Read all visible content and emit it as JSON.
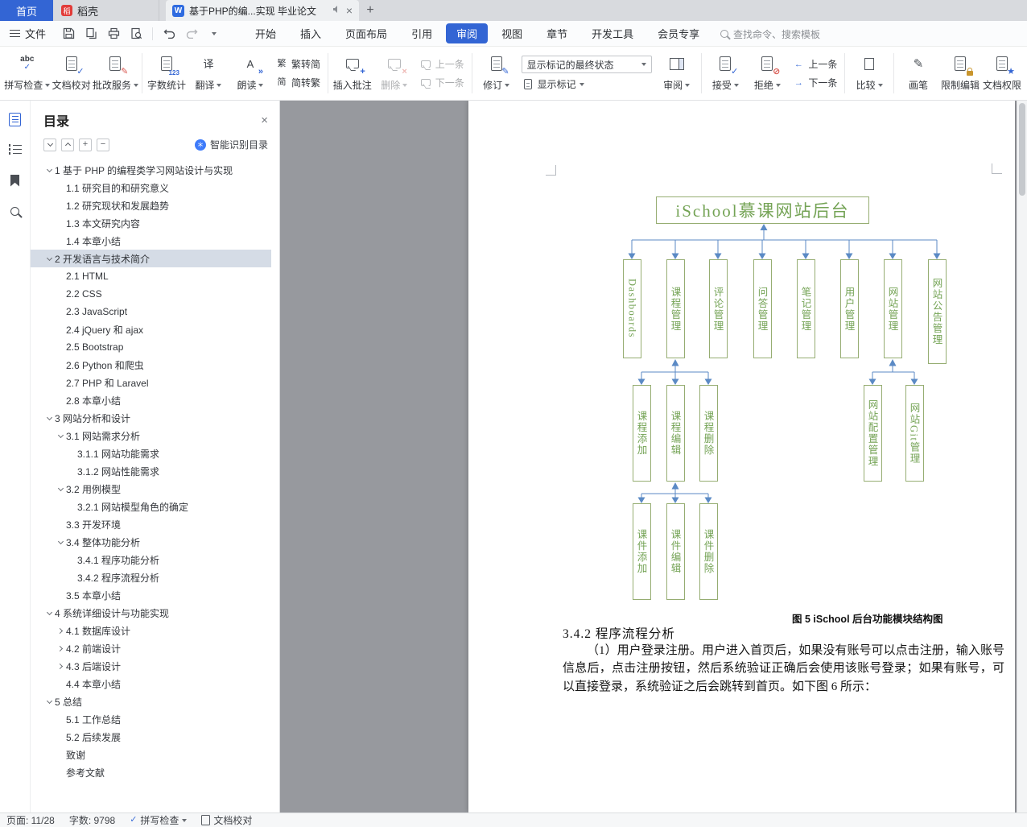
{
  "colors": {
    "accent": "#3365d4",
    "green-border": "#96ad72",
    "green-text": "#74a355",
    "connector": "#5b8ac5",
    "select-bg": "#d5dce6"
  },
  "tabbar": {
    "home": "首页",
    "docer": "稻壳",
    "doc_title": "基于PHP的编...实现 毕业论文",
    "add": "+"
  },
  "menubar": {
    "file": "文件",
    "menus": [
      "开始",
      "插入",
      "页面布局",
      "引用",
      "审阅",
      "视图",
      "章节",
      "开发工具",
      "会员专享"
    ],
    "active_menu": "审阅",
    "search": "查找命令、搜索模板"
  },
  "ribbon": {
    "spell_check": "拼写检查",
    "doc_proof": "文档校对",
    "correction": "批改服务",
    "word_count": "字数统计",
    "translate": "翻译",
    "read_aloud": "朗读",
    "trad_to_simp": "繁转简",
    "simp_to_trad": "简转繁",
    "insert_comment": "插入批注",
    "delete_comment": "删除",
    "prev_comment": "上一条",
    "next_comment": "下一条",
    "track_changes": "修订",
    "markup_final_state": "显示标记的最终状态",
    "show_markup": "显示标记",
    "review_pane": "审阅",
    "accept": "接受",
    "reject": "拒绝",
    "prev_change": "上一条",
    "next_change": "下一条",
    "compare": "比较",
    "ink": "画笔",
    "restrict_editing": "限制编辑",
    "doc_permission": "文档权限"
  },
  "nav": {
    "title": "目录",
    "smart_recognize": "智能识别目录",
    "toc": [
      {
        "label": "1 基于 PHP 的编程类学习网站设计与实现",
        "level": 1,
        "chev": "down"
      },
      {
        "label": "1.1 研究目的和研究意义",
        "level": 2,
        "chev": ""
      },
      {
        "label": "1.2 研究现状和发展趋势",
        "level": 2,
        "chev": ""
      },
      {
        "label": "1.3 本文研究内容",
        "level": 2,
        "chev": ""
      },
      {
        "label": "1.4 本章小结",
        "level": 2,
        "chev": ""
      },
      {
        "label": "2 开发语言与技术简介",
        "level": 1,
        "chev": "down",
        "selected": true
      },
      {
        "label": "2.1 HTML",
        "level": 2,
        "chev": ""
      },
      {
        "label": "2.2 CSS",
        "level": 2,
        "chev": ""
      },
      {
        "label": "2.3 JavaScript",
        "level": 2,
        "chev": ""
      },
      {
        "label": "2.4 jQuery 和 ajax",
        "level": 2,
        "chev": ""
      },
      {
        "label": "2.5 Bootstrap",
        "level": 2,
        "chev": ""
      },
      {
        "label": "2.6 Python 和爬虫",
        "level": 2,
        "chev": ""
      },
      {
        "label": "2.7 PHP 和 Laravel",
        "level": 2,
        "chev": ""
      },
      {
        "label": "2.8 本章小结",
        "level": 2,
        "chev": ""
      },
      {
        "label": "3 网站分析和设计",
        "level": 1,
        "chev": "down"
      },
      {
        "label": "3.1 网站需求分析",
        "level": 2,
        "chev": "down"
      },
      {
        "label": "3.1.1 网站功能需求",
        "level": 3,
        "chev": ""
      },
      {
        "label": "3.1.2 网站性能需求",
        "level": 3,
        "chev": ""
      },
      {
        "label": "3.2 用例模型",
        "level": 2,
        "chev": "down"
      },
      {
        "label": "3.2.1 网站模型角色的确定",
        "level": 3,
        "chev": ""
      },
      {
        "label": "3.3 开发环境",
        "level": 2,
        "chev": ""
      },
      {
        "label": "3.4 整体功能分析",
        "level": 2,
        "chev": "down"
      },
      {
        "label": "3.4.1 程序功能分析",
        "level": 3,
        "chev": ""
      },
      {
        "label": "3.4.2 程序流程分析",
        "level": 3,
        "chev": ""
      },
      {
        "label": "3.5 本章小结",
        "level": 2,
        "chev": ""
      },
      {
        "label": "4 系统详细设计与功能实现",
        "level": 1,
        "chev": "down"
      },
      {
        "label": "4.1 数据库设计",
        "level": 2,
        "chev": "right"
      },
      {
        "label": "4.2 前端设计",
        "level": 2,
        "chev": "right"
      },
      {
        "label": "4.3 后端设计",
        "level": 2,
        "chev": "right"
      },
      {
        "label": "4.4 本章小结",
        "level": 2,
        "chev": ""
      },
      {
        "label": "5 总结",
        "level": 1,
        "chev": "down"
      },
      {
        "label": "5.1 工作总结",
        "level": 2,
        "chev": ""
      },
      {
        "label": "5.2 后续发展",
        "level": 2,
        "chev": ""
      },
      {
        "label": "致谢",
        "level": 2,
        "chev": ""
      },
      {
        "label": "参考文献",
        "level": 2,
        "chev": ""
      }
    ]
  },
  "document": {
    "diagram": {
      "root": "iSchool慕课网站后台",
      "level1": [
        "Dashboards",
        "课程管理",
        "评论管理",
        "问答管理",
        "笔记管理",
        "用户管理",
        "网站管理",
        "网站公告管理"
      ],
      "course_children": [
        "课程添加",
        "课程编辑",
        "课程删除"
      ],
      "courseware_children": [
        "课件添加",
        "课件编辑",
        "课件删除"
      ],
      "site_children": [
        "网站配置管理",
        "网站Git管理"
      ],
      "caption": "图 5 iSchool 后台功能模块结构图"
    },
    "heading": "3.4.2 程序流程分析",
    "paragraph": "（1）用户登录注册。用户进入首页后，如果没有账号可以点击注册，输入账号信息后，点击注册按钮，然后系统验证正确后会使用该账号登录；如果有账号，可以直接登录，系统验证之后会跳转到首页。如下图 6 所示："
  },
  "statusbar": {
    "page": "页面: 11/28",
    "words": "字数: 9798",
    "spell": "拼写检查",
    "proof": "文档校对"
  }
}
